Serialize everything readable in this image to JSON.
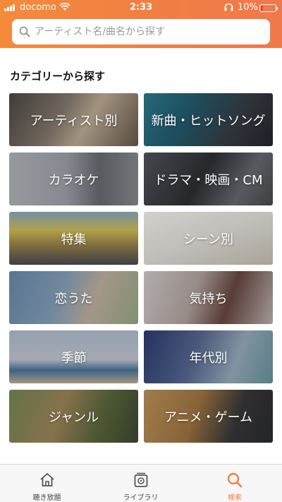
{
  "status_bar": {
    "carrier": "docomo",
    "time": "2:33",
    "battery_percent": "10%"
  },
  "search": {
    "placeholder": "アーティスト名/曲名から探す"
  },
  "section_title": "カテゴリーから探す",
  "categories": [
    {
      "label": "アーティスト別"
    },
    {
      "label": "新曲・ヒットソング"
    },
    {
      "label": "カラオケ"
    },
    {
      "label": "ドラマ・映画・CM"
    },
    {
      "label": "特集"
    },
    {
      "label": "シーン別"
    },
    {
      "label": "恋うた"
    },
    {
      "label": "気持ち"
    },
    {
      "label": "季節"
    },
    {
      "label": "年代別"
    },
    {
      "label": "ジャンル"
    },
    {
      "label": "アニメ・ゲーム"
    }
  ],
  "tabs": [
    {
      "label": "聴き放題",
      "icon": "home-icon"
    },
    {
      "label": "ライブラリ",
      "icon": "library-icon"
    },
    {
      "label": "検索",
      "icon": "search-icon"
    }
  ],
  "colors": {
    "accent": "#f07f43"
  }
}
